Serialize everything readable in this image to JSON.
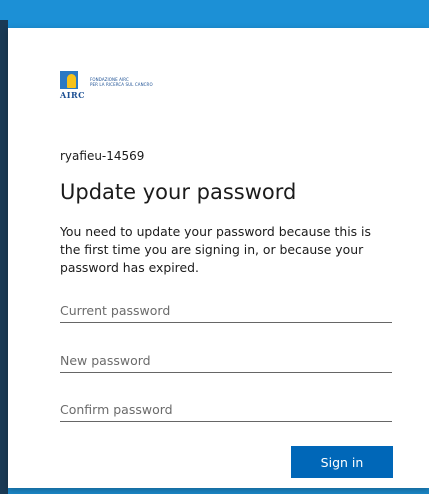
{
  "logo": {
    "wordmark": "AIRC",
    "line1": "FONDAZIONE AIRC",
    "line2": "PER LA RICERCA SUL CANCRO"
  },
  "account": {
    "username": "ryafieu-14569"
  },
  "form": {
    "title": "Update your password",
    "description": "You need to update your password because this is the first time you are signing in, or because your password has expired.",
    "current_password_placeholder": "Current password",
    "new_password_placeholder": "New password",
    "confirm_password_placeholder": "Confirm password",
    "submit_label": "Sign in"
  },
  "colors": {
    "background": "#1c8ccf",
    "button": "#0067b8"
  }
}
